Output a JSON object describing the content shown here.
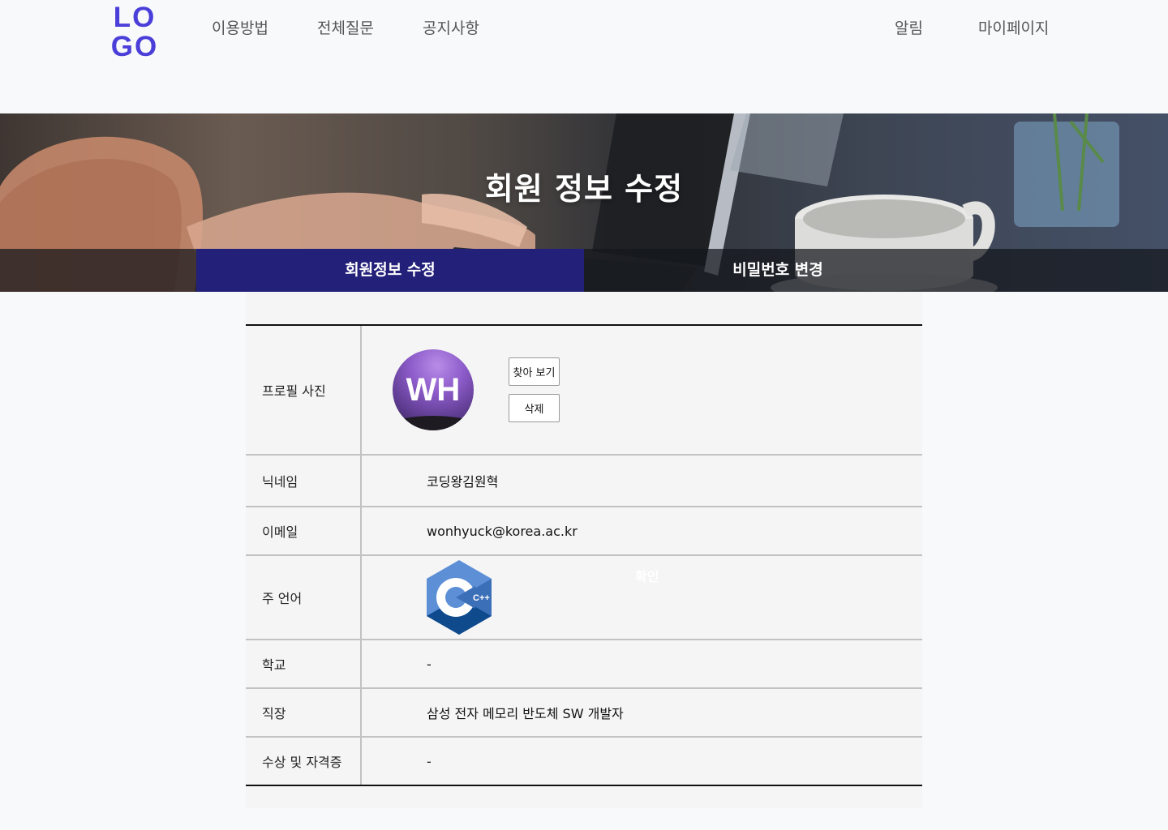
{
  "header": {
    "logo_line1": "LO",
    "logo_line2": "GO",
    "nav_left": [
      "이용방법",
      "전체질문",
      "공지사항"
    ],
    "nav_right": [
      "알림",
      "마이페이지"
    ]
  },
  "banner": {
    "title": "회원 정보 수정",
    "tabs": [
      {
        "label": "회원정보 수정",
        "active": true
      },
      {
        "label": "비밀번호 변경",
        "active": false
      }
    ]
  },
  "profile": {
    "photo_label": "프로필 사진",
    "avatar_initials": "WH",
    "browse_button": "찾아 보기",
    "delete_button": "삭제",
    "nickname_label": "닉네임",
    "nickname": "코딩왕김원혁",
    "email_label": "이메일",
    "email": "wonhyuck@korea.ac.kr",
    "language_label": "주 언어",
    "language_icon": "cpp-logo-icon",
    "language_logo_text": "C++",
    "confirm_label": "확인",
    "school_label": "학교",
    "school": "-",
    "workplace_label": "직장",
    "workplace": "삼성 전자 메모리 반도체 SW 개발자",
    "awards_label": "수상 및 자격증",
    "awards": "-"
  },
  "colors": {
    "accent": "#4b3fd9",
    "active_tab": "#23207a",
    "cpp_light": "#5c8fd6",
    "cpp_dark": "#0f4a8c"
  }
}
